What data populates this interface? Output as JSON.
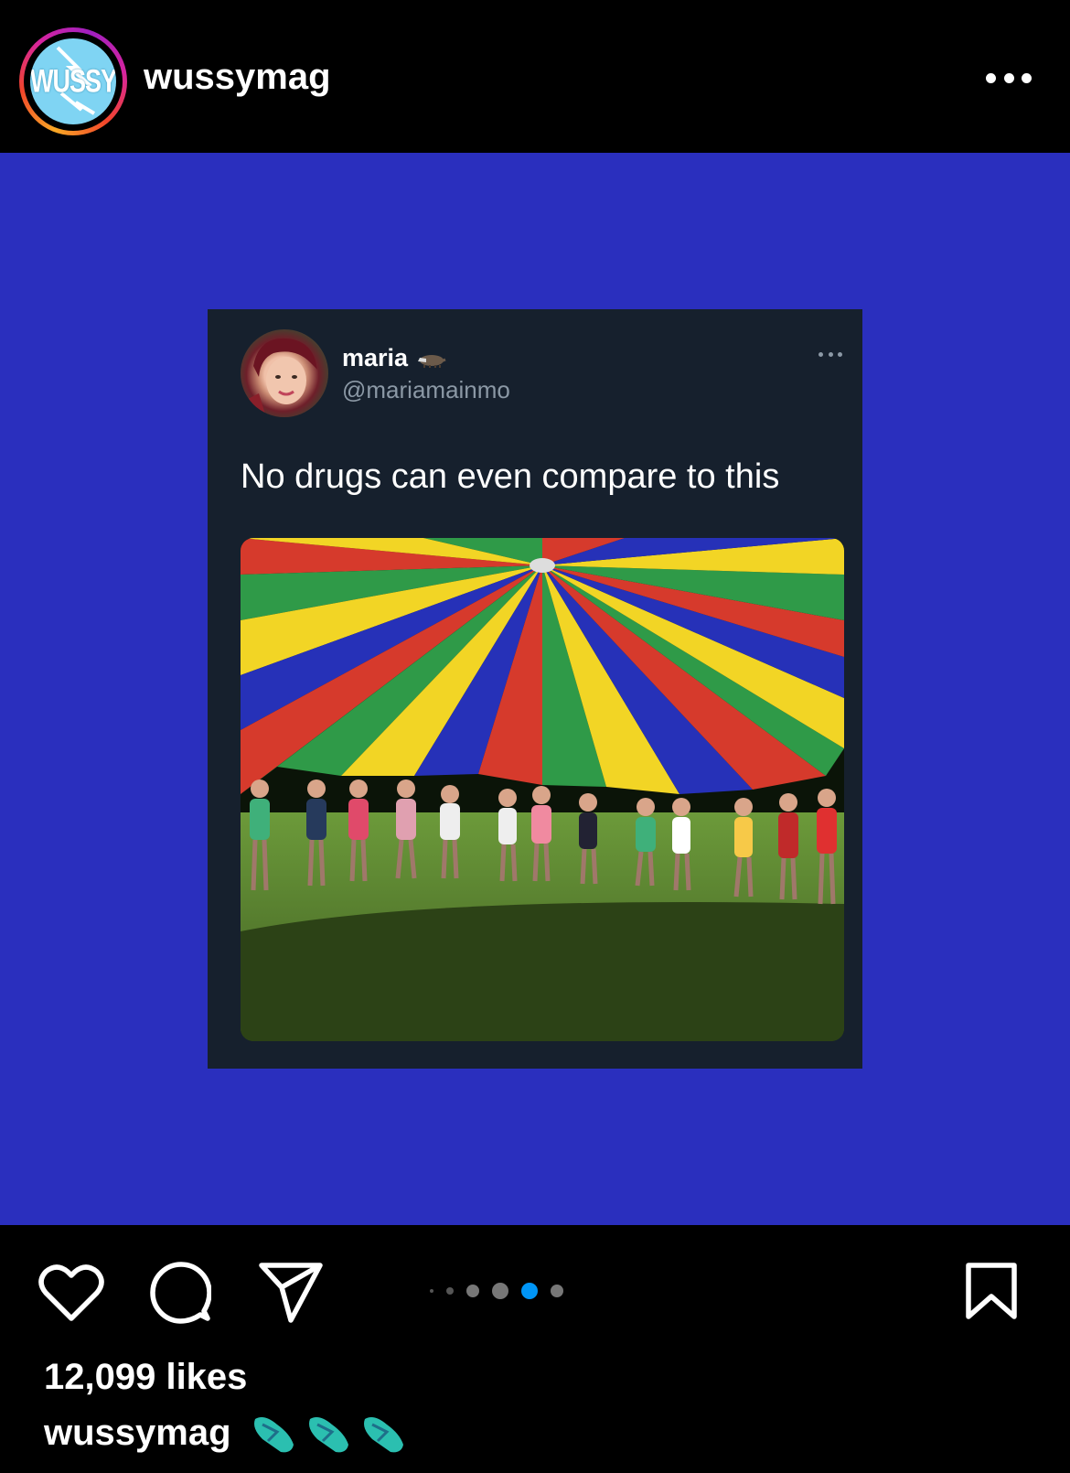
{
  "header": {
    "avatar_text": "WUSSY",
    "username": "wussymag",
    "more_icon": "more-horizontal-icon"
  },
  "post": {
    "background_color": "#2a2fbe",
    "tweet": {
      "name": "maria",
      "name_emoji": "badger",
      "handle": "@mariamainmo",
      "text": "No drugs can even compare to this",
      "media_description_icon": "photo"
    }
  },
  "actions": {
    "like_icon": "heart-icon",
    "comment_icon": "comment-icon",
    "share_icon": "send-icon",
    "save_icon": "bookmark-icon",
    "carousel": {
      "total": 6,
      "active_index": 4
    },
    "accent_color": "#0095f6"
  },
  "stats": {
    "likes": "12,099 likes"
  },
  "caption": {
    "username": "wussymag",
    "emojis": [
      "thong-sandal",
      "thong-sandal",
      "thong-sandal"
    ]
  }
}
